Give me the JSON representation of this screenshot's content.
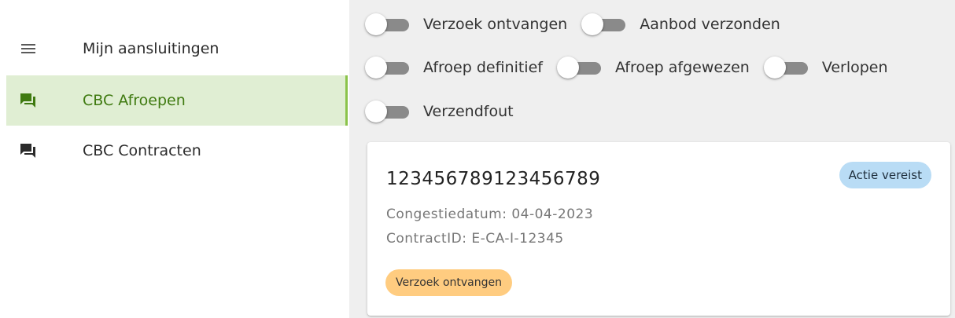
{
  "sidebar": {
    "items": [
      {
        "label": "Mijn aansluitingen",
        "icon": "menu-icon",
        "active": false
      },
      {
        "label": "CBC Afroepen",
        "icon": "chat-icon",
        "active": true
      },
      {
        "label": "CBC Contracten",
        "icon": "chat-icon",
        "active": false
      }
    ]
  },
  "filters": {
    "items": [
      {
        "label": "Verzoek ontvangen",
        "on": false
      },
      {
        "label": "Aanbod verzonden",
        "on": false
      },
      {
        "label": "Afroep definitief",
        "on": false
      },
      {
        "label": "Afroep afgewezen",
        "on": false
      },
      {
        "label": "Verlopen",
        "on": false
      },
      {
        "label": "Verzendfout",
        "on": false
      }
    ]
  },
  "card": {
    "title": "123456789123456789",
    "action_badge": "Actie vereist",
    "congestion_date": "Congestiedatum: 04-04-2023",
    "contract_id": "ContractID: E-CA-I-12345",
    "status_badge": "Verzoek ontvangen"
  },
  "colors": {
    "active_bg": "#e0eed3",
    "active_accent": "#8bc34a",
    "active_text": "#3f7a10",
    "action_badge": "#b9dcf5",
    "status_badge": "#ffcc80",
    "main_bg": "#efefef"
  }
}
